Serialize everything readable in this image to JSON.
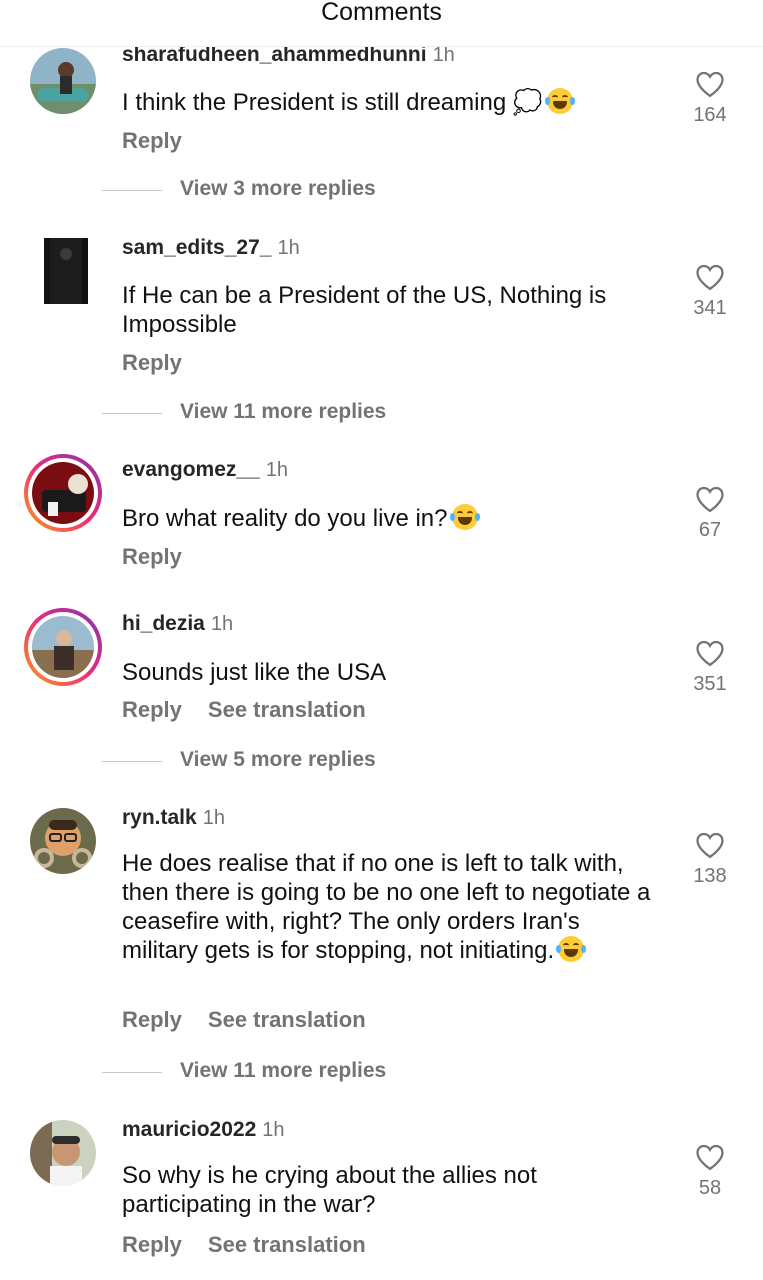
{
  "header": {
    "title": "Comments"
  },
  "comments": [
    {
      "username": "sharafudheen_ahammedhunni",
      "time": "1h",
      "text": "I think the President is still dreaming 💭",
      "reply": "Reply",
      "translate": "",
      "likes": "164",
      "view_replies": "View 3 more replies"
    },
    {
      "username": "sam_edits_27_",
      "time": "1h",
      "text": "If He can be a President of the US, Nothing is Impossible",
      "reply": "Reply",
      "translate": "",
      "likes": "341",
      "view_replies": "View 11 more replies"
    },
    {
      "username": "evangomez__",
      "time": "1h",
      "text": "Bro what reality do you live in?",
      "reply": "Reply",
      "translate": "",
      "likes": "67",
      "view_replies": ""
    },
    {
      "username": "hi_dezia",
      "time": "1h",
      "text": "Sounds just like the USA",
      "reply": "Reply",
      "translate": "See translation",
      "likes": "351",
      "view_replies": "View 5 more replies"
    },
    {
      "username": "ryn.talk",
      "time": "1h",
      "text": "He does realise that if no one is left to talk with, then there is going to be no one left to negotiate a ceasefire with, right? The only orders Iran's military gets is for stopping, not initiating.",
      "reply": "Reply",
      "translate": "See translation",
      "likes": "138",
      "view_replies": "View 11 more replies"
    },
    {
      "username": "mauricio2022",
      "time": "1h",
      "text": "So why is he crying about the allies not participating in the war?",
      "reply": "Reply",
      "translate": "See translation",
      "likes": "58",
      "view_replies": ""
    }
  ]
}
